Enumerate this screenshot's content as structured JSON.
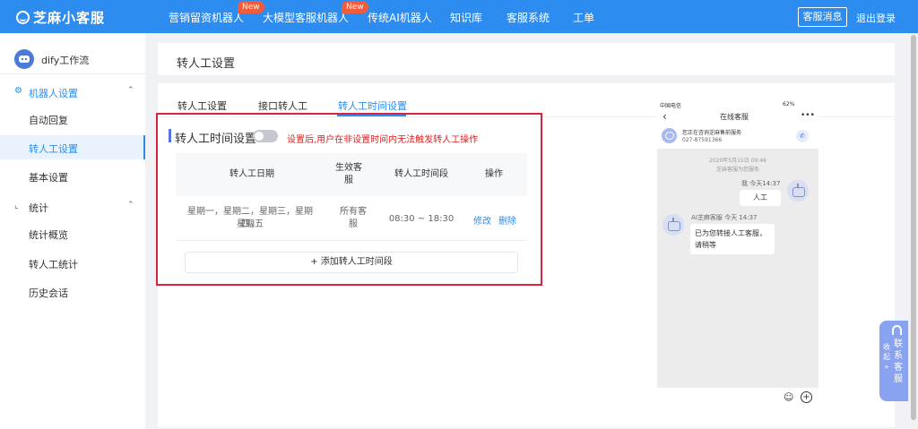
{
  "header": {
    "brand": "芝麻小客服",
    "nav": [
      {
        "label": "营销留资机器人",
        "badge": "New"
      },
      {
        "label": "大模型客服机器人",
        "badge": "New"
      },
      {
        "label": "传统AI机器人"
      },
      {
        "label": "知识库"
      },
      {
        "label": "客服系统"
      },
      {
        "label": "工单"
      }
    ],
    "msg_button": "客服消息",
    "logout": "退出登录"
  },
  "sidebar": {
    "bot_name": "dify工作流",
    "groups": [
      {
        "label": "机器人设置",
        "items": [
          "自动回复",
          "转人工设置",
          "基本设置"
        ]
      },
      {
        "label": "统计",
        "items": [
          "统计概览",
          "转人工统计",
          "历史会话"
        ]
      }
    ],
    "active_item": "转人工设置"
  },
  "page": {
    "title": "转人工设置",
    "tabs": [
      "转人工设置",
      "接口转人工",
      "转人工时间设置"
    ],
    "active_tab": "转人工时间设置"
  },
  "section": {
    "title": "转人工时间设置",
    "toggle_on": false,
    "hint": "设置后,用户在非设置时间内无法触发转人工操作"
  },
  "table": {
    "headers": {
      "date": "转人工日期",
      "service_line1": "生效客",
      "service_line2": "服",
      "period": "转人工时间段",
      "ops": "操作"
    },
    "rows": [
      {
        "date_line1": "星期一，星期二，星期三，星期四，",
        "date_line2": "星期五",
        "service": "所有客",
        "service_line2": "服",
        "period": "08:30 ~ 18:30",
        "edit": "修改",
        "delete": "删除"
      }
    ],
    "add_button": "+ 添加转人工时间段"
  },
  "phone": {
    "status_left": "中国电信",
    "status_right": "62%",
    "title": "在线客服",
    "service_name": "您正在咨询芝麻售前服务",
    "service_phone": "027-87591366",
    "date": "2020年5月15日 09:46",
    "tip": "芝麻客服为您服务",
    "me_name": "我 今天14:37",
    "me_message": "人工",
    "ai_name": "AI芝麻客服 今天 14:37",
    "ai_message": "已为您转接人工客服，请稍等"
  },
  "float_widget": {
    "collapse": "收起 »",
    "label": "联系客服"
  },
  "colors": {
    "primary": "#2d8cf0",
    "warning_red": "#e02020",
    "highlight_box": "#d9243f"
  }
}
